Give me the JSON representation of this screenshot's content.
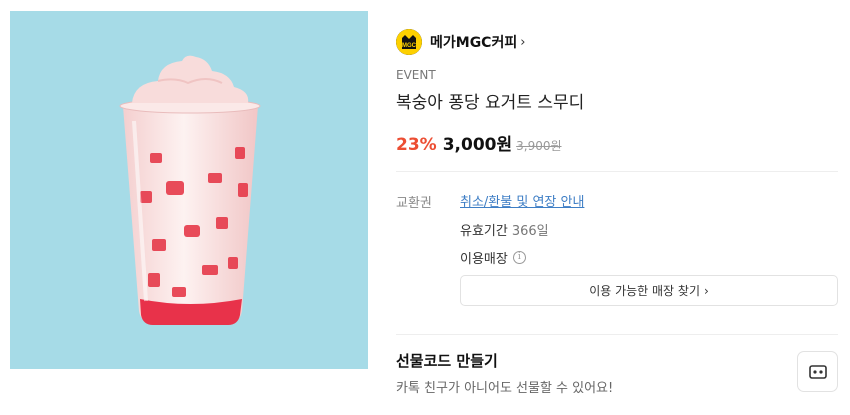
{
  "brand": {
    "name": "메가MGC커피",
    "logo_text": "MGC",
    "chevron": "›"
  },
  "product": {
    "event_tag": "EVENT",
    "title": "복숭아 퐁당 요거트 스무디",
    "discount": "23%",
    "price": "3,000원",
    "original_price": "3,900원"
  },
  "info": {
    "label": "교환권",
    "policy_link": "취소/환불 및 연장 안내",
    "validity_label": "유효기간",
    "validity_value": "366일",
    "stores_label": "이용매장",
    "find_store_button": "이용 가능한 매장 찾기"
  },
  "gift": {
    "title": "선물코드 만들기",
    "description": "카톡 친구가 아니어도 선물할 수 있어요!"
  },
  "colors": {
    "image_bg": "#a6dbe7",
    "discount": "#ec4e33",
    "link": "#3e7ec5"
  },
  "icons": [
    "megacoffee-logo",
    "chevron-right-icon",
    "info-icon",
    "gift-code-icon"
  ]
}
